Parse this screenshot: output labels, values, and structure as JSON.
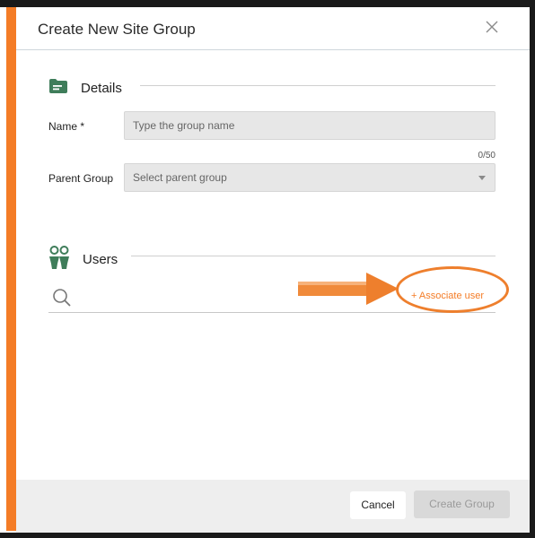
{
  "dialog": {
    "title": "Create New Site Group",
    "close_icon": "close-icon"
  },
  "details": {
    "section_label": "Details",
    "icon": "folder-icon",
    "name_label": "Name *",
    "name_placeholder": "Type the group name",
    "name_counter": "0/50",
    "parent_label": "Parent Group",
    "parent_placeholder": "Select parent group"
  },
  "users": {
    "section_label": "Users",
    "icon": "users-icon",
    "search_icon": "search-icon",
    "associate_link": "+ Associate user"
  },
  "footer": {
    "cancel_label": "Cancel",
    "create_label": "Create Group"
  },
  "colors": {
    "accent": "#f47c26",
    "icon_green": "#3f7d5a"
  }
}
